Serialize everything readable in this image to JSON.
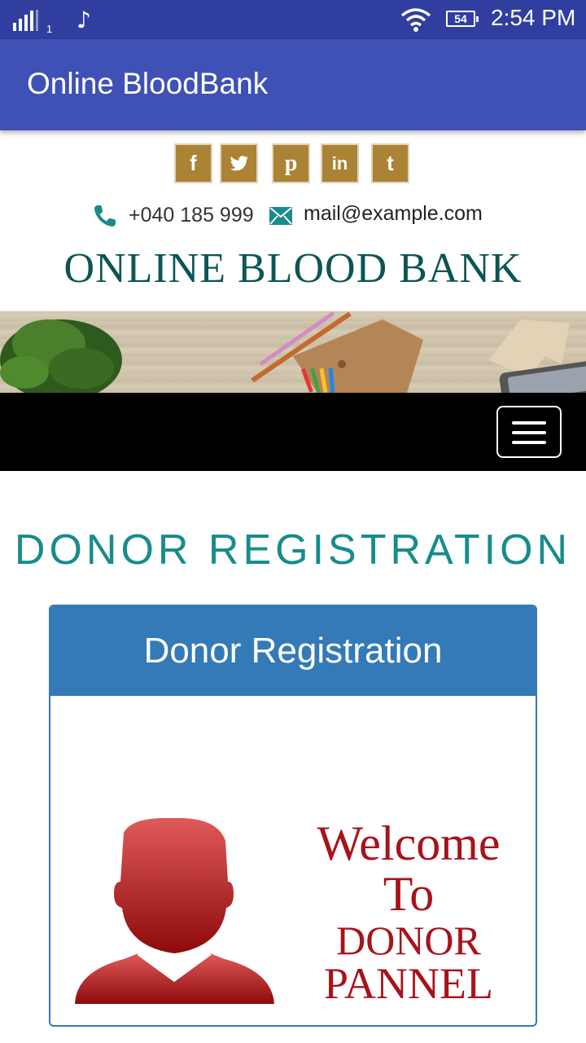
{
  "status_bar": {
    "sim_number": "1",
    "battery_level": "54",
    "time": "2:54 PM"
  },
  "app_bar": {
    "title": "Online BloodBank"
  },
  "social": {
    "items": [
      {
        "icon": "facebook-icon",
        "glyph": "f"
      },
      {
        "icon": "twitter-icon",
        "glyph": "🐦"
      },
      {
        "icon": "pinterest-icon",
        "glyph": "p"
      },
      {
        "icon": "linkedin-icon",
        "glyph": "in"
      },
      {
        "icon": "tumblr-icon",
        "glyph": "t"
      }
    ]
  },
  "contact": {
    "phone": "+040 185 999",
    "email": "mail@example.com"
  },
  "site_title": "ONLINE BLOOD BANK",
  "section_heading": "DONOR REGISTRATION",
  "panel": {
    "title": "Donor Registration",
    "welcome_lines": [
      "Welcome",
      "To",
      "DONOR",
      "PANNEL"
    ]
  },
  "colors": {
    "status_bar": "#303f9f",
    "app_bar": "#3f51b5",
    "social_button": "#ab8334",
    "teal_accent": "#178c8c",
    "panel_blue": "#337ab7",
    "welcome_red": "#a8121b"
  }
}
